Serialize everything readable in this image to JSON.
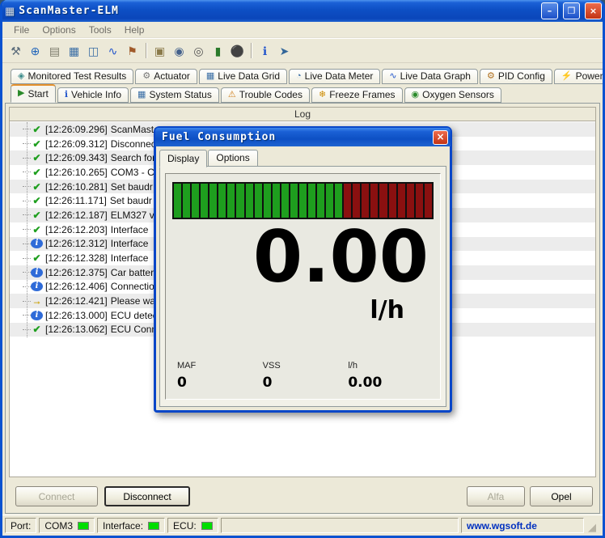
{
  "window": {
    "title": "ScanMaster-ELM",
    "app_icon_glyph": "▦",
    "minimize_label": "–",
    "maximize_label": "❐",
    "close_label": "×"
  },
  "menu": {
    "items": [
      "File",
      "Options",
      "Tools",
      "Help"
    ]
  },
  "toolbar": {
    "separators_after": [
      6,
      11
    ],
    "icons": [
      {
        "name": "wrench-icon",
        "glyph": "⚒",
        "color": "#5a6b7a"
      },
      {
        "name": "globe-icon",
        "glyph": "⊕",
        "color": "#2266bb"
      },
      {
        "name": "report-icon",
        "glyph": "▤",
        "color": "#7a7a6a"
      },
      {
        "name": "grid-icon",
        "glyph": "▦",
        "color": "#3a6ea5"
      },
      {
        "name": "panel-icon",
        "glyph": "◫",
        "color": "#3a6ea5"
      },
      {
        "name": "wave-icon",
        "glyph": "∿",
        "color": "#2255cc"
      },
      {
        "name": "flag-icon",
        "glyph": "⚑",
        "color": "#a05a2a"
      },
      {
        "name": "clipboard-icon",
        "glyph": "▣",
        "color": "#8a7a4a"
      },
      {
        "name": "search-icon",
        "glyph": "◉",
        "color": "#44618c"
      },
      {
        "name": "camera-icon",
        "glyph": "◎",
        "color": "#555555"
      },
      {
        "name": "battery-icon",
        "glyph": "▮",
        "color": "#2a7a2a"
      },
      {
        "name": "record-icon",
        "glyph": "⚫",
        "color": "#333333"
      },
      {
        "name": "info-icon",
        "glyph": "ℹ",
        "color": "#2255cc"
      },
      {
        "name": "exit-icon",
        "glyph": "➤",
        "color": "#336699"
      }
    ]
  },
  "tabs_row1": [
    {
      "label": "Monitored Test Results",
      "icon": "◈",
      "icon_name": "monitored-tests-icon",
      "color": "#3a8a8a"
    },
    {
      "label": "Actuator",
      "icon": "⚙",
      "icon_name": "actuator-icon",
      "color": "#777777"
    },
    {
      "label": "Live Data Grid",
      "icon": "▦",
      "icon_name": "live-data-grid-icon",
      "color": "#3a6ea5"
    },
    {
      "label": "Live Data Meter",
      "icon": "◔",
      "icon_name": "live-data-meter-icon",
      "color": "#3a6ea5"
    },
    {
      "label": "Live Data Graph",
      "icon": "∿",
      "icon_name": "live-data-graph-icon",
      "color": "#2255cc"
    },
    {
      "label": "PID Config",
      "icon": "⚙",
      "icon_name": "pid-config-icon",
      "color": "#b07020"
    },
    {
      "label": "Power",
      "icon": "⚡",
      "icon_name": "power-icon",
      "color": "#555555"
    }
  ],
  "tabs_row2": [
    {
      "label": "Start",
      "icon": "▶",
      "icon_name": "start-icon",
      "color": "#2a8a2a",
      "active": true
    },
    {
      "label": "Vehicle Info",
      "icon": "ℹ",
      "icon_name": "vehicle-info-icon",
      "color": "#2255cc"
    },
    {
      "label": "System Status",
      "icon": "▦",
      "icon_name": "system-status-icon",
      "color": "#3a6ea5"
    },
    {
      "label": "Trouble Codes",
      "icon": "⚠",
      "icon_name": "trouble-codes-icon",
      "color": "#d08020"
    },
    {
      "label": "Freeze Frames",
      "icon": "❄",
      "icon_name": "freeze-frames-icon",
      "color": "#cc8a00"
    },
    {
      "label": "Oxygen Sensors",
      "icon": "◉",
      "icon_name": "oxygen-sensors-icon",
      "color": "#2a8a2a"
    }
  ],
  "log": {
    "header": "Log",
    "entries": [
      {
        "time": "[12:26:09.296]",
        "text": "ScanMaste",
        "icon": "check"
      },
      {
        "time": "[12:26:09.312]",
        "text": "Disconnec",
        "icon": "check"
      },
      {
        "time": "[12:26:09.343]",
        "text": "Search for",
        "icon": "check"
      },
      {
        "time": "[12:26:10.265]",
        "text": "COM3 - C",
        "icon": "check"
      },
      {
        "time": "[12:26:10.281]",
        "text": "Set baudr",
        "icon": "check"
      },
      {
        "time": "[12:26:11.171]",
        "text": "Set baudr",
        "icon": "check"
      },
      {
        "time": "[12:26:12.187]",
        "text": "ELM327 v",
        "icon": "check"
      },
      {
        "time": "[12:26:12.203]",
        "text": "Interface",
        "icon": "check"
      },
      {
        "time": "[12:26:12.312]",
        "text": "Interface",
        "icon": "info"
      },
      {
        "time": "[12:26:12.328]",
        "text": "Interface",
        "icon": "check"
      },
      {
        "time": "[12:26:12.375]",
        "text": "Car batter",
        "icon": "info"
      },
      {
        "time": "[12:26:12.406]",
        "text": "Connectio",
        "icon": "info"
      },
      {
        "time": "[12:26:12.421]",
        "text": "Please wa",
        "icon": "arrow"
      },
      {
        "time": "[12:26:13.000]",
        "text": "ECU detec",
        "icon": "info"
      },
      {
        "time": "[12:26:13.062]",
        "text": "ECU Conn",
        "icon": "check"
      }
    ]
  },
  "dialog": {
    "title": "Fuel Consumption",
    "close_label": "×",
    "tabs": [
      {
        "label": "Display",
        "active": true
      },
      {
        "label": "Options"
      }
    ],
    "gauge": {
      "total_segments": 29,
      "green_segments": 19,
      "green_color": "#1e9e1e",
      "red_color": "#8a1010"
    },
    "value": "0.00",
    "unit": "l/h",
    "readouts": [
      {
        "label": "MAF",
        "value": "0"
      },
      {
        "label": "VSS",
        "value": "0"
      },
      {
        "label": "l/h",
        "value": "0.00"
      }
    ]
  },
  "buttons": {
    "connect": {
      "label": "Connect",
      "enabled": false
    },
    "disconnect": {
      "label": "Disconnect",
      "enabled": true,
      "default": true
    },
    "alfa": {
      "label": "Alfa",
      "enabled": false
    },
    "opel": {
      "label": "Opel",
      "enabled": true
    }
  },
  "statusbar": {
    "port_label": "Port:",
    "port_value": "COM3",
    "interface_label": "Interface:",
    "ecu_label": "ECU:",
    "website": "www.wgsoft.de"
  }
}
